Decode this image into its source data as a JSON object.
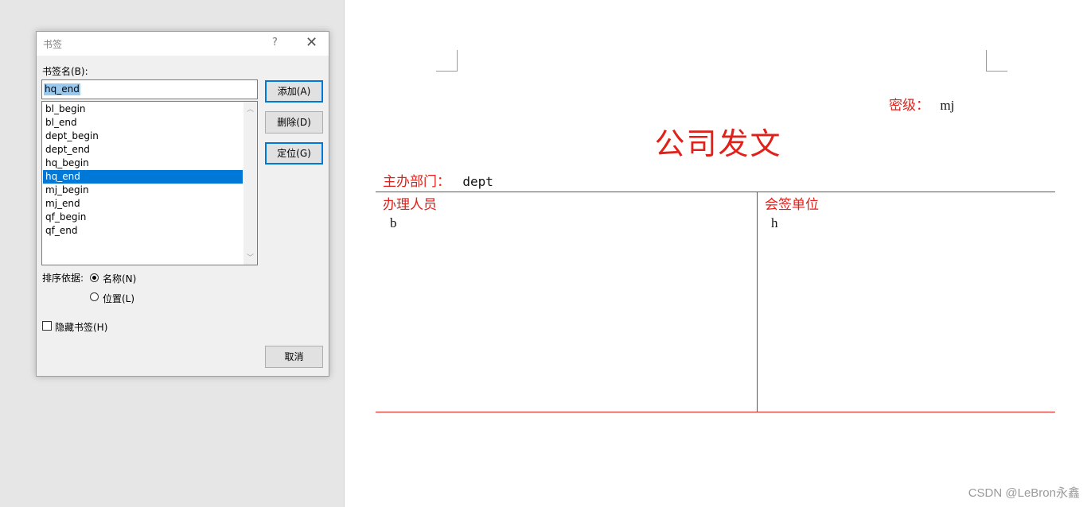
{
  "dialog": {
    "title": "书签",
    "help_glyph": "?",
    "close_glyph": "✕",
    "name_label": "书签名(B):",
    "name_value": "hq_end",
    "bookmarks": [
      "bl_begin",
      "bl_end",
      "dept_begin",
      "dept_end",
      "hq_begin",
      "hq_end",
      "mj_begin",
      "mj_end",
      "qf_begin",
      "qf_end"
    ],
    "selected_index": 5,
    "buttons": {
      "add": "添加(A)",
      "delete": "删除(D)",
      "goto": "定位(G)",
      "cancel": "取消"
    },
    "sort_label": "排序依据:",
    "sort_by_name": "名称(N)",
    "sort_by_location": "位置(L)",
    "sort_selected": "name",
    "hide_bookmarks": "隐藏书签(H)",
    "hide_checked": false
  },
  "document": {
    "secret_label": "密级：",
    "secret_value": "mj",
    "title": "公司发文",
    "dept_label": "主办部门：",
    "dept_value": "dept",
    "handler_label": "办理人员",
    "handler_value": "b",
    "countersign_label": "会签单位",
    "countersign_value": "h",
    "accent_color": "#e1201a"
  },
  "watermark": "CSDN @LeBron永鑫"
}
